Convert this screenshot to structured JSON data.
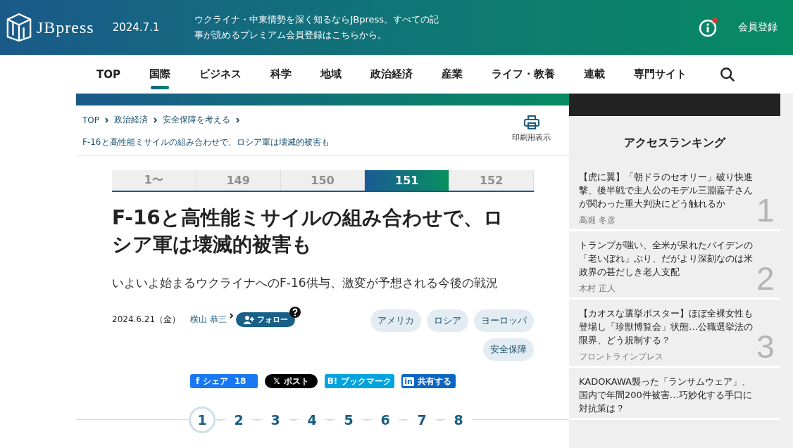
{
  "header": {
    "logo": "JBpress",
    "date": "2024.7.1",
    "promo": "ウクライナ・中東情勢を深く知るならJBpress。すべての記事が読めるプレミアム会員登録はこちらから。",
    "notification": true,
    "register": "会員登録"
  },
  "nav": [
    {
      "label": "TOP",
      "selected": false
    },
    {
      "label": "国際",
      "selected": true
    },
    {
      "label": "ビジネス",
      "selected": false
    },
    {
      "label": "科学",
      "selected": false
    },
    {
      "label": "地域",
      "selected": false
    },
    {
      "label": "政治経済",
      "selected": false
    },
    {
      "label": "産業",
      "selected": false
    },
    {
      "label": "ライフ・教養",
      "selected": false
    },
    {
      "label": "連載",
      "selected": false
    },
    {
      "label": "専門サイト",
      "selected": false
    }
  ],
  "breadcrumb": [
    "TOP",
    "政治経済",
    "安全保障を考える"
  ],
  "breadcrumb_current": "F-16と高性能ミサイルの組み合わせで、ロシア軍は壊滅的被害も",
  "print_label": "印刷用表示",
  "series_tabs": [
    {
      "label": "1〜",
      "selected": false
    },
    {
      "label": "149",
      "selected": false
    },
    {
      "label": "150",
      "selected": false
    },
    {
      "label": "151",
      "selected": true
    },
    {
      "label": "152",
      "selected": false
    }
  ],
  "article": {
    "title": "F-16と高性能ミサイルの組み合わせで、ロシア軍は壊滅的被害も",
    "subtitle": "いよいよ始まるウクライナへのF-16供与、激変が予想される今後の戦況",
    "date": "2024.6.21（金）",
    "author": "横山 恭三",
    "follow": "フォロー",
    "tags": [
      "アメリカ",
      "ロシア",
      "ヨーロッパ",
      "安全保障"
    ]
  },
  "share": [
    {
      "kind": "facebook",
      "icon": "f",
      "label": "シェア",
      "count": "18"
    },
    {
      "kind": "x",
      "icon": "𝕏",
      "label": "ポスト"
    },
    {
      "kind": "hatena",
      "icon": "B!",
      "label": "ブックマーク"
    },
    {
      "kind": "linkedin",
      "icon": "in",
      "label": "共有する"
    }
  ],
  "pages": [
    {
      "label": "1",
      "selected": true
    },
    {
      "label": "2",
      "selected": false
    },
    {
      "label": "3",
      "selected": false
    },
    {
      "label": "4",
      "selected": false
    },
    {
      "label": "5",
      "selected": false
    },
    {
      "label": "6",
      "selected": false
    },
    {
      "label": "7",
      "selected": false
    },
    {
      "label": "8",
      "selected": false
    }
  ],
  "ranking": {
    "title": "アクセスランキング",
    "items": [
      {
        "title": "【虎に翼】「朝ドラのセオリー」破り快進撃、後半戦で主人公のモデル三淵嘉子さんが関わった重大判決にどう触れるか",
        "author": "高堀 冬彦",
        "rank": "1"
      },
      {
        "title": "トランプが嗤い、全米が呆れたバイデンの「老いぼれ」ぶり、だがより深刻なのは米政界の甚だしき老人支配",
        "author": "木村 正人",
        "rank": "2"
      },
      {
        "title": "【カオスな選挙ポスター】ほぼ全裸女性も登場し「珍獣博覧会」状態…公職選挙法の限界、どう規制する？",
        "author": "フロントラインプレス",
        "rank": "3"
      },
      {
        "title": "KADOKAWA襲った「ランサムウェア」、国内で年間200件被害…巧妙化する手口に対抗策は？"
      }
    ]
  }
}
